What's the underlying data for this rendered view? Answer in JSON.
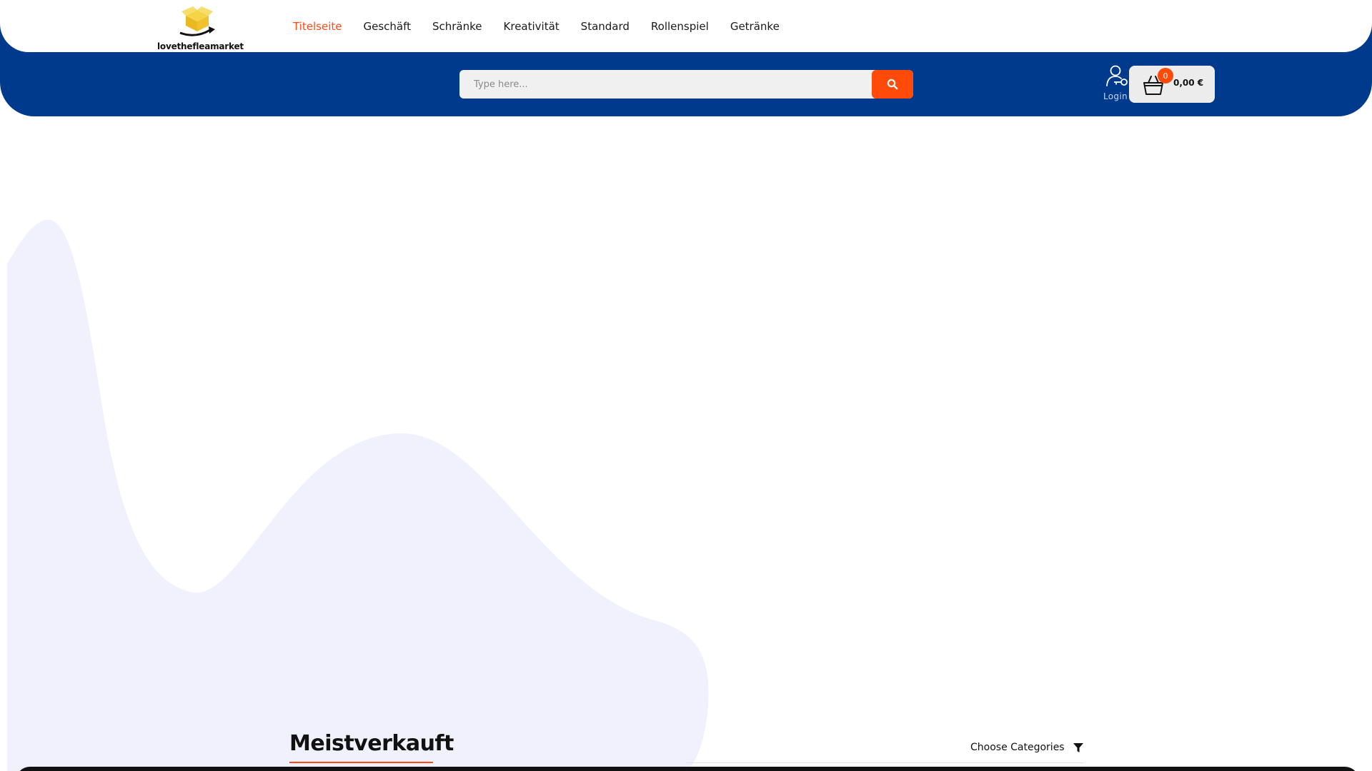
{
  "brand": {
    "logo_text": "lovethefleamarket",
    "accent_color": "#ff4a17",
    "header_color": "#003a8c"
  },
  "nav": {
    "items": [
      {
        "label": "Titelseite",
        "active": true
      },
      {
        "label": "Geschäft",
        "active": false
      },
      {
        "label": "Schränke",
        "active": false
      },
      {
        "label": "Kreativität",
        "active": false
      },
      {
        "label": "Standard",
        "active": false
      },
      {
        "label": "Rollenspiel",
        "active": false
      },
      {
        "label": "Getränke",
        "active": false
      }
    ]
  },
  "search": {
    "placeholder": "Type here...",
    "value": "",
    "button_icon": "search-icon"
  },
  "account": {
    "login_label": "Login",
    "icon": "user-key-icon"
  },
  "cart": {
    "count": "0",
    "total": "0,00 €",
    "icon": "basket-icon"
  },
  "section": {
    "title": "Meistverkauft",
    "filter_label": "Choose Categories",
    "filter_icon": "filter-icon"
  }
}
